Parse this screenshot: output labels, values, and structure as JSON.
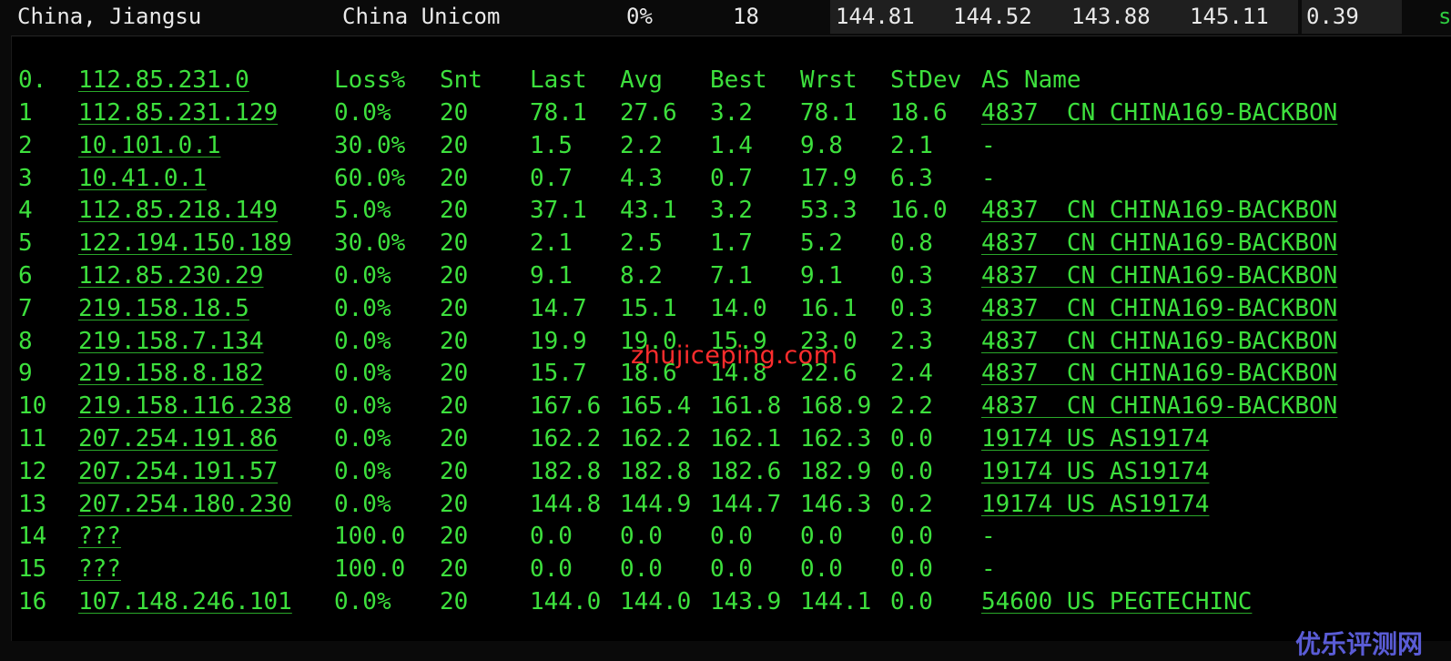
{
  "summary": {
    "location": "China, Jiangsu",
    "isp": "China Unicom",
    "loss": "0%",
    "count": "18",
    "v1": "144.81",
    "v2": "144.52",
    "v3": "143.88",
    "v4": "145.11",
    "v5": "0.39",
    "edge": "s"
  },
  "header": {
    "host": "0.  112.85.231.0",
    "loss": "Loss%",
    "snt": "Snt",
    "last": "Last",
    "avg": "Avg",
    "best": "Best",
    "wrst": "Wrst",
    "stdev": "StDev",
    "asname": "AS Name"
  },
  "hops": [
    {
      "n": "1",
      "ip": "112.85.231.129",
      "loss": "0.0%",
      "snt": "20",
      "last": "78.1",
      "avg": "27.6",
      "best": "3.2",
      "wrst": "78.1",
      "stdev": "18.6",
      "as": "4837  CN CHINA169-BACKBON"
    },
    {
      "n": "2",
      "ip": "10.101.0.1",
      "loss": "30.0%",
      "snt": "20",
      "last": "1.5",
      "avg": "2.2",
      "best": "1.4",
      "wrst": "9.8",
      "stdev": "2.1",
      "as": "-"
    },
    {
      "n": "3",
      "ip": "10.41.0.1",
      "loss": "60.0%",
      "snt": "20",
      "last": "0.7",
      "avg": "4.3",
      "best": "0.7",
      "wrst": "17.9",
      "stdev": "6.3",
      "as": "-"
    },
    {
      "n": "4",
      "ip": "112.85.218.149",
      "loss": "5.0%",
      "snt": "20",
      "last": "37.1",
      "avg": "43.1",
      "best": "3.2",
      "wrst": "53.3",
      "stdev": "16.0",
      "as": "4837  CN CHINA169-BACKBON"
    },
    {
      "n": "5",
      "ip": "122.194.150.189",
      "loss": "30.0%",
      "snt": "20",
      "last": "2.1",
      "avg": "2.5",
      "best": "1.7",
      "wrst": "5.2",
      "stdev": "0.8",
      "as": "4837  CN CHINA169-BACKBON"
    },
    {
      "n": "6",
      "ip": "112.85.230.29",
      "loss": "0.0%",
      "snt": "20",
      "last": "9.1",
      "avg": "8.2",
      "best": "7.1",
      "wrst": "9.1",
      "stdev": "0.3",
      "as": "4837  CN CHINA169-BACKBON"
    },
    {
      "n": "7",
      "ip": "219.158.18.5",
      "loss": "0.0%",
      "snt": "20",
      "last": "14.7",
      "avg": "15.1",
      "best": "14.0",
      "wrst": "16.1",
      "stdev": "0.3",
      "as": "4837  CN CHINA169-BACKBON"
    },
    {
      "n": "8",
      "ip": "219.158.7.134",
      "loss": "0.0%",
      "snt": "20",
      "last": "19.9",
      "avg": "19.0",
      "best": "15.9",
      "wrst": "23.0",
      "stdev": "2.3",
      "as": "4837  CN CHINA169-BACKBON"
    },
    {
      "n": "9",
      "ip": "219.158.8.182",
      "loss": "0.0%",
      "snt": "20",
      "last": "15.7",
      "avg": "18.6",
      "best": "14.8",
      "wrst": "22.6",
      "stdev": "2.4",
      "as": "4837  CN CHINA169-BACKBON"
    },
    {
      "n": "10",
      "ip": "219.158.116.238",
      "loss": "0.0%",
      "snt": "20",
      "last": "167.6",
      "avg": "165.4",
      "best": "161.8",
      "wrst": "168.9",
      "stdev": "2.2",
      "as": "4837  CN CHINA169-BACKBON"
    },
    {
      "n": "11",
      "ip": "207.254.191.86",
      "loss": "0.0%",
      "snt": "20",
      "last": "162.2",
      "avg": "162.2",
      "best": "162.1",
      "wrst": "162.3",
      "stdev": "0.0",
      "as": "19174 US AS19174"
    },
    {
      "n": "12",
      "ip": "207.254.191.57",
      "loss": "0.0%",
      "snt": "20",
      "last": "182.8",
      "avg": "182.8",
      "best": "182.6",
      "wrst": "182.9",
      "stdev": "0.0",
      "as": "19174 US AS19174"
    },
    {
      "n": "13",
      "ip": "207.254.180.230",
      "loss": "0.0%",
      "snt": "20",
      "last": "144.8",
      "avg": "144.9",
      "best": "144.7",
      "wrst": "146.3",
      "stdev": "0.2",
      "as": "19174 US AS19174"
    },
    {
      "n": "14",
      "ip": "???",
      "loss": "100.0",
      "snt": "20",
      "last": "0.0",
      "avg": "0.0",
      "best": "0.0",
      "wrst": "0.0",
      "stdev": "0.0",
      "as": "-"
    },
    {
      "n": "15",
      "ip": "???",
      "loss": "100.0",
      "snt": "20",
      "last": "0.0",
      "avg": "0.0",
      "best": "0.0",
      "wrst": "0.0",
      "stdev": "0.0",
      "as": "-"
    },
    {
      "n": "16",
      "ip": "107.148.246.101",
      "loss": "0.0%",
      "snt": "20",
      "last": "144.0",
      "avg": "144.0",
      "best": "143.9",
      "wrst": "144.1",
      "stdev": "0.0",
      "as": "54600 US PEGTECHINC"
    }
  ],
  "watermark": "zhujiceping.com",
  "logo": "优乐评测网",
  "colors": {
    "text_green": "#3de03d",
    "background": "#000000",
    "watermark_red": "#ff2d2d",
    "logo_blue": "#5a5cd6"
  }
}
